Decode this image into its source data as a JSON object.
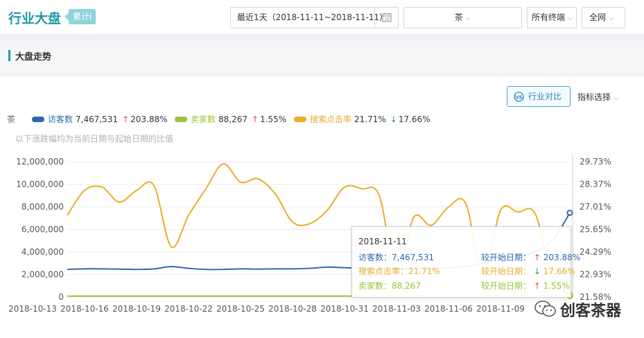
{
  "header": {
    "title": "行业大盘",
    "badge": "累计i",
    "date_range": "最近1天（2018-11-11~2018-11-11）",
    "category": "茶",
    "terminal": "所有终端",
    "network": "全网",
    "chevron": "⌵"
  },
  "section": {
    "title": "大盘走势"
  },
  "toolbar": {
    "compare_label": "行业对比",
    "metric_select": "指标选择"
  },
  "legend": {
    "category": "茶",
    "items": [
      {
        "name": "访客数",
        "value": "7,467,531",
        "arrow": "↑",
        "change": "203.88%",
        "color": "#2c6aad"
      },
      {
        "name": "卖家数",
        "value": "88,267",
        "arrow": "↑",
        "change": "1.55%",
        "color": "#9bc43a"
      },
      {
        "name": "搜索点击率",
        "value": "21.71%",
        "arrow": "↓",
        "change": "17.66%",
        "color": "#e9ad2a"
      }
    ]
  },
  "note": "以下涨跌幅均为当前日期与起始日期的比值",
  "chart_data": {
    "type": "line",
    "x": [
      "2018-10-13",
      "2018-10-14",
      "2018-10-15",
      "2018-10-16",
      "2018-10-17",
      "2018-10-18",
      "2018-10-19",
      "2018-10-20",
      "2018-10-21",
      "2018-10-22",
      "2018-10-23",
      "2018-10-24",
      "2018-10-25",
      "2018-10-26",
      "2018-10-27",
      "2018-10-28",
      "2018-10-29",
      "2018-10-30",
      "2018-10-31",
      "2018-11-01",
      "2018-11-02",
      "2018-11-03",
      "2018-11-04",
      "2018-11-05",
      "2018-11-06",
      "2018-11-07",
      "2018-11-08",
      "2018-11-09",
      "2018-11-10",
      "2018-11-11"
    ],
    "x_tick_labels": [
      "2018-10-13",
      "2018-10-16",
      "2018-10-19",
      "2018-10-22",
      "2018-10-25",
      "2018-10-28",
      "2018-10-31",
      "2018-11-03",
      "2018-11-06",
      "2018-11-09"
    ],
    "y_left": {
      "ticks": [
        "0",
        "2,000,000",
        "4,000,000",
        "6,000,000",
        "8,000,000",
        "10,000,000",
        "12,000,000"
      ],
      "range": [
        0,
        12000000
      ]
    },
    "y_right": {
      "ticks": [
        "21.58%",
        "22.93%",
        "24.29%",
        "25.65%",
        "27.01%",
        "28.37%",
        "29.73%"
      ],
      "range": [
        21.58,
        29.73
      ]
    },
    "grid": true,
    "series": [
      {
        "name": "访客数",
        "axis": "left",
        "color": "#2c6aad",
        "values": [
          2450000,
          2500000,
          2500000,
          2480000,
          2450000,
          2500000,
          2700000,
          2550000,
          2450000,
          2450000,
          2500000,
          2480000,
          2500000,
          2500000,
          2550000,
          2650000,
          2600000,
          2550000,
          2500000,
          2500000,
          2550000,
          2550000,
          2600000,
          2700000,
          3000000,
          3400000,
          3700000,
          4000000,
          5000000,
          7467531
        ]
      },
      {
        "name": "卖家数",
        "axis": "left",
        "color": "#9bc43a",
        "values": [
          85000,
          86000,
          86000,
          86000,
          86000,
          86500,
          86500,
          87000,
          87000,
          87000,
          87000,
          87000,
          87000,
          87500,
          87500,
          87500,
          87500,
          87500,
          87500,
          87500,
          87500,
          88000,
          88000,
          88000,
          88000,
          88000,
          88000,
          88000,
          88000,
          88267
        ]
      },
      {
        "name": "搜索点击率",
        "axis": "right",
        "color": "#e9ad2a",
        "values": [
          26.5,
          28.0,
          28.2,
          27.3,
          28.0,
          28.3,
          24.6,
          26.5,
          28.1,
          29.6,
          28.5,
          28.7,
          27.8,
          26.1,
          26.0,
          26.8,
          28.2,
          28.1,
          27.7,
          23.0,
          26.4,
          25.9,
          27.0,
          27.2,
          22.8,
          26.8,
          26.7,
          26.6,
          22.8,
          21.71
        ]
      }
    ]
  },
  "tooltip": {
    "date": "2018-11-11",
    "rows": [
      {
        "label": "访客数：7,467,531",
        "compare": "较开始日期：",
        "arrow": "↑",
        "change": "203.88%",
        "color": "#2c6aad"
      },
      {
        "label": "搜索点击率：21.71%",
        "compare": "较开始日期：",
        "arrow": "↓",
        "change": "17.66%",
        "color": "#e9ad2a"
      },
      {
        "label": "卖家数：88,267",
        "compare": "较开始日期：",
        "arrow": "↑",
        "change": "1.55%",
        "color": "#9bc43a"
      }
    ]
  },
  "watermark": {
    "text": "创客茶器"
  }
}
